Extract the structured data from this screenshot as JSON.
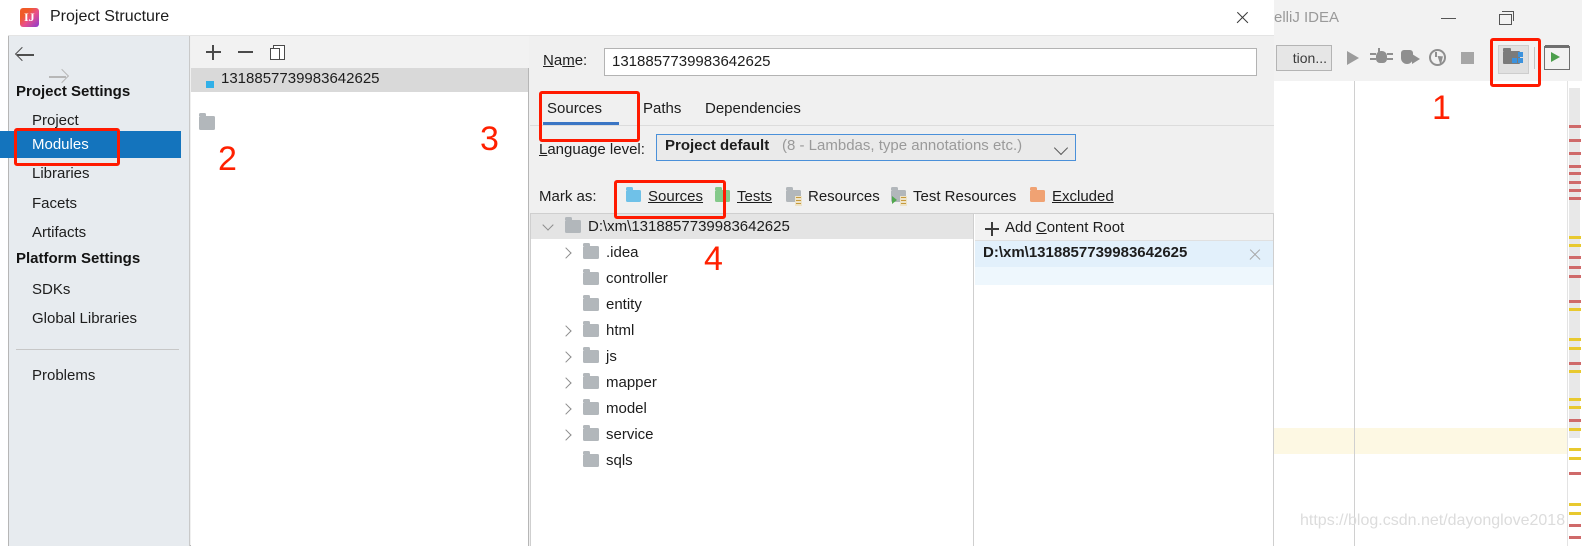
{
  "ide_window": {
    "title": "elliJ IDEA",
    "toolbar": {
      "run_config_label": "tion...",
      "icons": [
        "run-icon",
        "debug-icon",
        "run-with-coverage-icon",
        "profiler-icon",
        "stop-icon",
        "project-structure-icon",
        "terminal-icon"
      ]
    },
    "watermark": "https://blog.csdn.net/dayonglove2018"
  },
  "dialog": {
    "title": "Project Structure",
    "icon": "intellij-idea-logo-icon",
    "close_label": "close-icon",
    "nav": {
      "back": "back-arrow-icon",
      "forward": "forward-arrow-icon"
    },
    "sidebar": {
      "groups": [
        {
          "label": "Project Settings",
          "items": [
            "Project",
            "Modules",
            "Libraries",
            "Facets",
            "Artifacts"
          ]
        },
        {
          "label": "Platform Settings",
          "items": [
            "SDKs",
            "Global Libraries"
          ]
        }
      ],
      "footer_items": [
        "Problems"
      ],
      "selected": "Modules",
      "selected_color": "#1474bd"
    },
    "modules_panel": {
      "toolbar": {
        "add": "add-icon",
        "remove": "remove-icon",
        "copy": "copy-icon"
      },
      "items": [
        {
          "label": "1318857739983642625",
          "selected": true
        }
      ]
    },
    "detail": {
      "name_label": "Name:",
      "name_value": "1318857739983642625",
      "tabs": [
        {
          "label": "Sources",
          "active": true
        },
        {
          "label": "Paths",
          "active": false
        },
        {
          "label": "Dependencies",
          "active": false
        }
      ],
      "language_level": {
        "label": "Language level:",
        "value": "Project default",
        "hint": "(8 - Lambdas, type annotations etc.)",
        "chevron": "chevron-down-icon"
      },
      "mark_as": {
        "label": "Mark as:",
        "options": [
          {
            "label": "Sources",
            "color": "#6fc1e8",
            "highlighted": true
          },
          {
            "label": "Tests",
            "color": "#84c98a",
            "highlighted": false
          },
          {
            "label": "Resources",
            "color": "#b2b7bb",
            "highlighted": false
          },
          {
            "label": "Test Resources",
            "color": "#b2b7bb",
            "highlighted": false
          },
          {
            "label": "Excluded",
            "color": "#f0a273",
            "highlighted": false
          }
        ]
      },
      "tree": {
        "root": {
          "label": "D:\\xm\\1318857739983642625",
          "expanded": true
        },
        "children": [
          {
            "label": ".idea",
            "expandable": true
          },
          {
            "label": "controller",
            "expandable": false
          },
          {
            "label": "entity",
            "expandable": false
          },
          {
            "label": "html",
            "expandable": true
          },
          {
            "label": "js",
            "expandable": true
          },
          {
            "label": "mapper",
            "expandable": true
          },
          {
            "label": "model",
            "expandable": true
          },
          {
            "label": "service",
            "expandable": true
          },
          {
            "label": "sqls",
            "expandable": false
          }
        ]
      },
      "content_roots": {
        "add_label": "Add Content Root",
        "items": [
          {
            "label": "D:\\xm\\1318857739983642625"
          }
        ]
      }
    }
  },
  "annotations": {
    "numbers": [
      "1",
      "2",
      "3",
      "4"
    ],
    "color": "#ff2000"
  }
}
